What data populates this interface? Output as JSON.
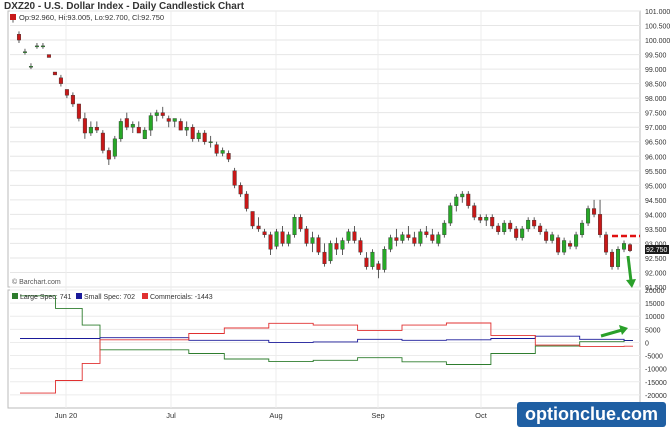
{
  "title": "DXZ20 - U.S. Dollar Index - Daily Candlestick Chart",
  "ohlc_text": "Op:92.960, Hi:93.005, Lo:92.700, Cl:92.750",
  "credit": "© Barchart.com",
  "watermark": "optionclue.com",
  "last_price_label": "92.750",
  "colors": {
    "up": "#27a827",
    "down": "#c81818",
    "large": "#2e7d2e",
    "small": "#1a1a9a",
    "commercials": "#e03030",
    "dash": "#e01010",
    "arrow": "#2aa02a"
  },
  "chart_data": [
    {
      "type": "candlestick",
      "ylim": [
        91.5,
        101.0
      ],
      "y_ticks": [
        "101.000",
        "100.500",
        "100.000",
        "99.500",
        "99.000",
        "98.500",
        "98.000",
        "97.500",
        "97.000",
        "96.500",
        "96.000",
        "95.500",
        "95.000",
        "94.500",
        "94.000",
        "93.500",
        "93.000",
        "92.500",
        "92.000",
        "91.500"
      ],
      "x_labels": [
        "Jun 20",
        "Jul",
        "Aug",
        "Sep",
        "Oct"
      ],
      "candles": [
        [
          100.8,
          100.9,
          100.6,
          100.8
        ],
        [
          100.2,
          100.3,
          99.9,
          100.0
        ],
        [
          99.6,
          99.7,
          99.5,
          99.6
        ],
        [
          99.1,
          99.2,
          99.0,
          99.1
        ],
        [
          99.8,
          99.9,
          99.7,
          99.8
        ],
        [
          99.8,
          99.9,
          99.7,
          99.8
        ],
        [
          99.5,
          99.5,
          99.4,
          99.4
        ],
        [
          98.9,
          98.9,
          98.8,
          98.8
        ],
        [
          98.7,
          98.8,
          98.4,
          98.5
        ],
        [
          98.3,
          98.3,
          98.0,
          98.1
        ],
        [
          98.1,
          98.2,
          97.7,
          97.8
        ],
        [
          97.8,
          97.8,
          97.2,
          97.3
        ],
        [
          97.3,
          97.5,
          96.6,
          96.8
        ],
        [
          96.8,
          97.2,
          96.7,
          97.0
        ],
        [
          97.0,
          97.2,
          96.8,
          96.9
        ],
        [
          96.8,
          96.9,
          96.1,
          96.2
        ],
        [
          96.2,
          96.3,
          95.7,
          95.9
        ],
        [
          96.0,
          96.7,
          95.9,
          96.6
        ],
        [
          96.6,
          97.3,
          96.5,
          97.2
        ],
        [
          97.3,
          97.5,
          96.9,
          97.0
        ],
        [
          97.0,
          97.2,
          96.8,
          97.1
        ],
        [
          97.0,
          97.2,
          96.8,
          96.8
        ],
        [
          96.6,
          97.0,
          96.6,
          96.9
        ],
        [
          96.9,
          97.5,
          96.7,
          97.4
        ],
        [
          97.4,
          97.6,
          97.2,
          97.5
        ],
        [
          97.5,
          97.7,
          97.3,
          97.4
        ],
        [
          97.3,
          97.4,
          97.0,
          97.2
        ],
        [
          97.2,
          97.3,
          97.0,
          97.3
        ],
        [
          97.2,
          97.3,
          96.9,
          96.9
        ],
        [
          96.9,
          97.2,
          96.7,
          97.0
        ],
        [
          97.0,
          97.1,
          96.5,
          96.6
        ],
        [
          96.6,
          96.9,
          96.5,
          96.8
        ],
        [
          96.8,
          96.9,
          96.4,
          96.5
        ],
        [
          96.5,
          96.7,
          96.3,
          96.5
        ],
        [
          96.4,
          96.5,
          96.0,
          96.1
        ],
        [
          96.1,
          96.3,
          96.0,
          96.2
        ],
        [
          96.1,
          96.2,
          95.8,
          95.9
        ],
        [
          95.5,
          95.6,
          94.9,
          95.0
        ],
        [
          95.0,
          95.1,
          94.6,
          94.7
        ],
        [
          94.7,
          94.8,
          94.1,
          94.2
        ],
        [
          94.1,
          94.1,
          93.5,
          93.6
        ],
        [
          93.6,
          93.9,
          93.4,
          93.5
        ],
        [
          93.4,
          93.5,
          93.2,
          93.3
        ],
        [
          93.3,
          93.4,
          92.6,
          92.8
        ],
        [
          92.9,
          93.5,
          92.8,
          93.4
        ],
        [
          93.4,
          93.6,
          92.9,
          93.0
        ],
        [
          93.0,
          93.4,
          92.9,
          93.3
        ],
        [
          93.3,
          94.0,
          93.2,
          93.9
        ],
        [
          93.9,
          94.0,
          93.4,
          93.5
        ],
        [
          93.5,
          93.6,
          92.9,
          93.0
        ],
        [
          93.0,
          93.4,
          92.7,
          93.2
        ],
        [
          93.2,
          93.3,
          92.6,
          92.7
        ],
        [
          92.7,
          93.0,
          92.2,
          92.3
        ],
        [
          92.4,
          93.1,
          92.3,
          93.0
        ],
        [
          93.0,
          93.2,
          92.6,
          92.8
        ],
        [
          92.8,
          93.2,
          92.6,
          93.1
        ],
        [
          93.1,
          93.5,
          93.0,
          93.4
        ],
        [
          93.4,
          93.6,
          93.0,
          93.1
        ],
        [
          93.1,
          93.2,
          92.6,
          92.7
        ],
        [
          92.5,
          92.7,
          92.1,
          92.2
        ],
        [
          92.2,
          92.8,
          92.1,
          92.7
        ],
        [
          92.3,
          92.4,
          91.8,
          92.1
        ],
        [
          92.1,
          92.9,
          92.0,
          92.8
        ],
        [
          92.8,
          93.3,
          92.7,
          93.2
        ],
        [
          93.2,
          93.5,
          92.9,
          93.1
        ],
        [
          93.1,
          93.4,
          93.0,
          93.3
        ],
        [
          93.3,
          93.6,
          93.1,
          93.2
        ],
        [
          93.2,
          93.4,
          92.9,
          93.0
        ],
        [
          93.0,
          93.5,
          92.9,
          93.4
        ],
        [
          93.4,
          93.6,
          93.2,
          93.3
        ],
        [
          93.3,
          93.5,
          93.0,
          93.1
        ],
        [
          93.0,
          93.4,
          92.9,
          93.3
        ],
        [
          93.3,
          93.8,
          93.2,
          93.7
        ],
        [
          93.7,
          94.4,
          93.6,
          94.3
        ],
        [
          94.3,
          94.7,
          94.1,
          94.6
        ],
        [
          94.6,
          94.8,
          94.4,
          94.7
        ],
        [
          94.7,
          94.8,
          94.2,
          94.3
        ],
        [
          94.3,
          94.4,
          93.8,
          93.9
        ],
        [
          93.9,
          94.0,
          93.7,
          93.8
        ],
        [
          93.8,
          94.0,
          93.6,
          93.9
        ],
        [
          93.9,
          94.0,
          93.5,
          93.6
        ],
        [
          93.6,
          93.7,
          93.3,
          93.4
        ],
        [
          93.4,
          93.8,
          93.3,
          93.7
        ],
        [
          93.7,
          93.8,
          93.4,
          93.5
        ],
        [
          93.5,
          93.6,
          93.1,
          93.2
        ],
        [
          93.2,
          93.6,
          93.1,
          93.5
        ],
        [
          93.5,
          93.9,
          93.4,
          93.8
        ],
        [
          93.8,
          93.9,
          93.5,
          93.6
        ],
        [
          93.6,
          93.7,
          93.3,
          93.4
        ],
        [
          93.4,
          93.5,
          93.0,
          93.1
        ],
        [
          93.1,
          93.4,
          93.0,
          93.3
        ],
        [
          93.2,
          93.3,
          92.6,
          92.7
        ],
        [
          92.7,
          93.2,
          92.6,
          93.1
        ],
        [
          93.0,
          93.1,
          92.8,
          92.9
        ],
        [
          92.9,
          93.4,
          92.8,
          93.3
        ],
        [
          93.3,
          93.8,
          93.2,
          93.7
        ],
        [
          93.7,
          94.3,
          93.6,
          94.2
        ],
        [
          94.2,
          94.5,
          93.9,
          94.0
        ],
        [
          94.0,
          94.5,
          93.2,
          93.3
        ],
        [
          93.3,
          93.4,
          92.6,
          92.7
        ],
        [
          92.7,
          92.8,
          92.1,
          92.2
        ],
        [
          92.2,
          92.9,
          92.1,
          92.8
        ],
        [
          92.8,
          93.1,
          92.7,
          93.0
        ],
        [
          92.96,
          93.005,
          92.7,
          92.75
        ]
      ]
    },
    {
      "type": "line",
      "ylim": [
        -25000,
        20000
      ],
      "y_ticks": [
        "20000",
        "15000",
        "10000",
        "5000",
        "0",
        "-5000",
        "-10000",
        "-15000",
        "-20000"
      ],
      "legend": [
        "Large Spec: 741",
        "Small Spec: 702",
        "Commercials: -1443"
      ],
      "series": [
        {
          "name": "Large Spec",
          "values": [
            17800,
            17800,
            17800,
            17800,
            13000,
            13000,
            13000,
            6600,
            6600,
            -2800,
            -2800,
            -2800,
            -2800,
            -2800,
            -2800,
            -2800,
            -2800,
            -2800,
            -2800,
            -4200,
            -4200,
            -4200,
            -4200,
            -6300,
            -6300,
            -6300,
            -6300,
            -6300,
            -7300,
            -7300,
            -7300,
            -7300,
            -7300,
            -6800,
            -6800,
            -6800,
            -6800,
            -6800,
            -5800,
            -5800,
            -5800,
            -5800,
            -5800,
            -7400,
            -7400,
            -7400,
            -7400,
            -7400,
            -8400,
            -8400,
            -8400,
            -8400,
            -8400,
            -4200,
            -4200,
            -4200,
            -4200,
            -4200,
            -1400,
            -1400,
            -1400,
            -1400,
            -1400,
            300,
            300,
            300,
            300,
            300,
            741,
            741
          ]
        },
        {
          "name": "Small Spec",
          "values": [
            1500,
            1500,
            1500,
            1500,
            1500,
            1500,
            1500,
            1500,
            1500,
            1800,
            1800,
            1800,
            1800,
            1800,
            1800,
            1800,
            1800,
            1800,
            1800,
            800,
            800,
            800,
            800,
            800,
            800,
            800,
            800,
            800,
            0,
            0,
            0,
            0,
            0,
            200,
            200,
            200,
            200,
            200,
            1200,
            1200,
            1200,
            1200,
            1200,
            800,
            800,
            800,
            800,
            800,
            1000,
            1000,
            1000,
            1000,
            1000,
            1500,
            1500,
            1500,
            1500,
            1500,
            2400,
            2400,
            2400,
            2400,
            2400,
            1200,
            1200,
            1200,
            1200,
            1200,
            702,
            702
          ]
        },
        {
          "name": "Commercials",
          "values": [
            -19300,
            -19300,
            -19300,
            -19300,
            -14500,
            -14500,
            -14500,
            -8000,
            -8000,
            1000,
            1000,
            1000,
            1000,
            1000,
            1000,
            1000,
            1000,
            1000,
            1000,
            3400,
            3400,
            3400,
            3400,
            5500,
            5500,
            5500,
            5500,
            5500,
            7300,
            7300,
            7300,
            7300,
            7300,
            6600,
            6600,
            6600,
            6600,
            6600,
            4600,
            4600,
            4600,
            4600,
            4600,
            6600,
            6600,
            6600,
            6600,
            6600,
            7400,
            7400,
            7400,
            7400,
            7400,
            2700,
            2700,
            2700,
            2700,
            2700,
            -1000,
            -1000,
            -1000,
            -1000,
            -1000,
            -1500,
            -1500,
            -1500,
            -1500,
            -1500,
            -1443,
            -1443
          ]
        }
      ]
    }
  ]
}
